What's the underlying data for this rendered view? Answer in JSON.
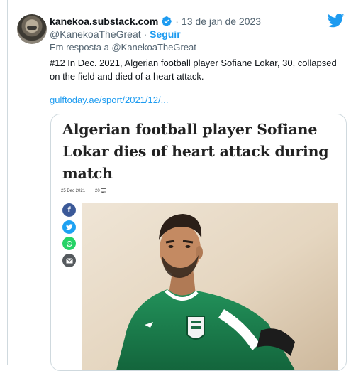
{
  "tweet": {
    "display_name": "kanekoa.substack.com",
    "date": "13 de jan de 2023",
    "handle": "@KanekoaTheGreat",
    "follow_label": "Seguir",
    "reply_prefix": "Em resposta a",
    "reply_handle": "@KanekoaTheGreat",
    "text": "#12 In Dec. 2021, Algerian football player Sofiane Lokar, 30, collapsed on the field and died of a heart attack.",
    "link": "gulftoday.ae/sport/2021/12/..."
  },
  "card": {
    "title": "Algerian football player Sofiane Lokar dies of heart attack during match",
    "date": "25 Dec 2021",
    "comment_count": "20"
  },
  "icons": {
    "verified": "verified-badge-icon",
    "logo": "twitter-bird-icon",
    "comment": "comment-icon",
    "share": [
      "facebook-icon",
      "twitter-icon",
      "whatsapp-icon",
      "email-icon"
    ]
  },
  "colors": {
    "accent": "#1d9bf0",
    "secondary_text": "#536471",
    "facebook": "#3b5998",
    "twitter": "#1da1f2",
    "whatsapp": "#25d366",
    "email": "#555a5e",
    "jersey": "#1b7a4b"
  }
}
